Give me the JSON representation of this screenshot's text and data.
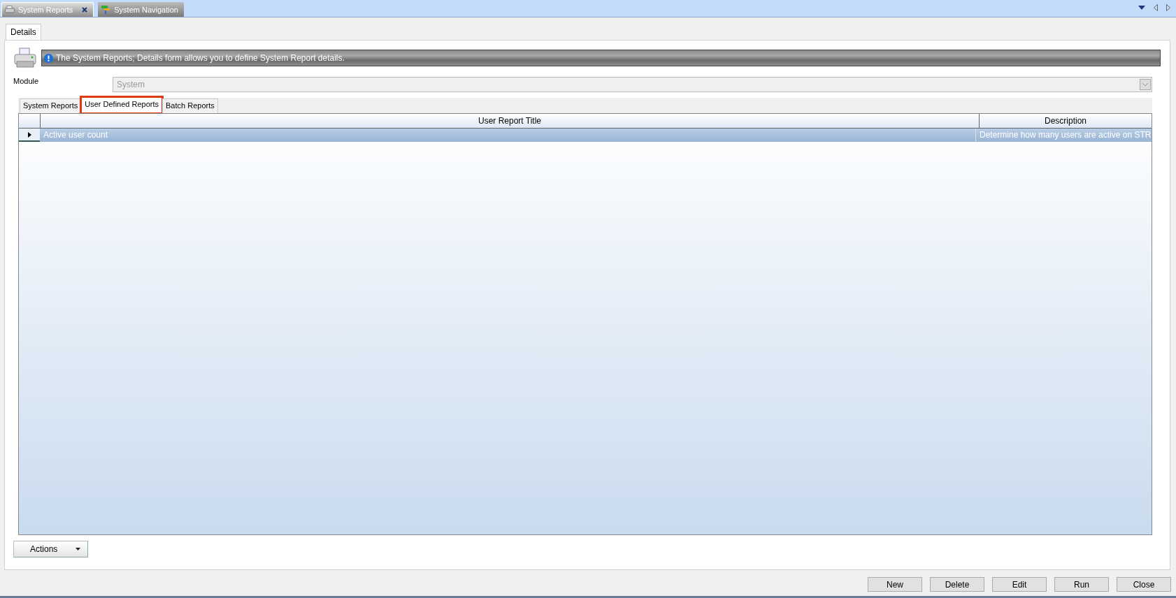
{
  "doc_tabs": [
    {
      "label": "System Reports",
      "selected": true,
      "closable": true
    },
    {
      "label": "System Navigation",
      "selected": false,
      "closable": false
    }
  ],
  "form_tabs": [
    {
      "label": "Details",
      "selected": true
    }
  ],
  "info_banner": {
    "text": "The System Reports; Details form allows you to define System Report details."
  },
  "module": {
    "label": "Module",
    "value": "System",
    "disabled": true
  },
  "report_tabs": [
    {
      "label": "System Reports",
      "selected": false,
      "highlighted": false
    },
    {
      "label": "User Defined Reports",
      "selected": true,
      "highlighted": true
    },
    {
      "label": "Batch Reports",
      "selected": false,
      "highlighted": false
    }
  ],
  "table": {
    "columns": [
      "User Report Title",
      "Description"
    ],
    "rows": [
      {
        "cells": [
          "Active user count",
          "Determine how many users are active on STR"
        ],
        "selected": true
      }
    ]
  },
  "actions_button": {
    "label": "Actions"
  },
  "buttons": [
    "New",
    "Delete",
    "Edit",
    "Run",
    "Close"
  ]
}
